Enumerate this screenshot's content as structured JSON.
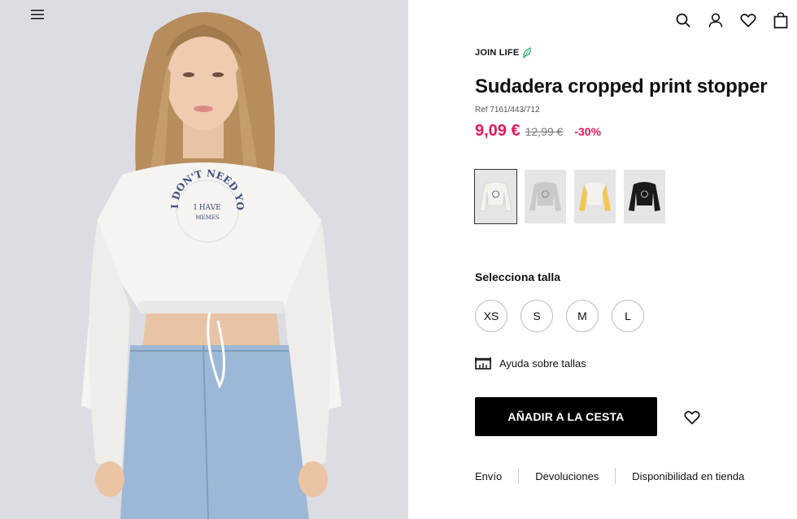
{
  "header": {
    "menu_icon": "menu-icon",
    "icons": [
      "search-icon",
      "user-icon",
      "heart-icon",
      "bag-icon"
    ]
  },
  "product": {
    "collection": "JOIN LIFE",
    "title": "Sudadera cropped print stopper",
    "ref": "Ref 7161/443/712",
    "price_now": "9,09 €",
    "price_old": "12,99 €",
    "discount": "-30%",
    "colors": [
      {
        "name": "white",
        "body": "#f4f2ee",
        "sleeve": "#f4f2ee",
        "selected": true
      },
      {
        "name": "grey",
        "body": "#c9c9c7",
        "sleeve": "#c9c9c7",
        "selected": false
      },
      {
        "name": "yellow-white",
        "body": "#f4f2ee",
        "sleeve": "#f2c84b",
        "selected": false
      },
      {
        "name": "black",
        "body": "#1a1a1a",
        "sleeve": "#1a1a1a",
        "selected": false
      }
    ],
    "size_label": "Selecciona talla",
    "sizes": [
      "XS",
      "S",
      "M",
      "L"
    ],
    "size_help": "Ayuda sobre tallas",
    "add_to_cart": "AÑADIR A LA CESTA",
    "links": [
      "Envío",
      "Devoluciones",
      "Disponibilidad en tienda"
    ],
    "print_text": {
      "outer": "I DON'T NEED YOU",
      "inner_1": "I HAVE",
      "inner_2": "MEMES"
    }
  },
  "colors": {
    "price_accent": "#e2175f",
    "leaf": "#3bb273",
    "button_bg": "#000000"
  }
}
